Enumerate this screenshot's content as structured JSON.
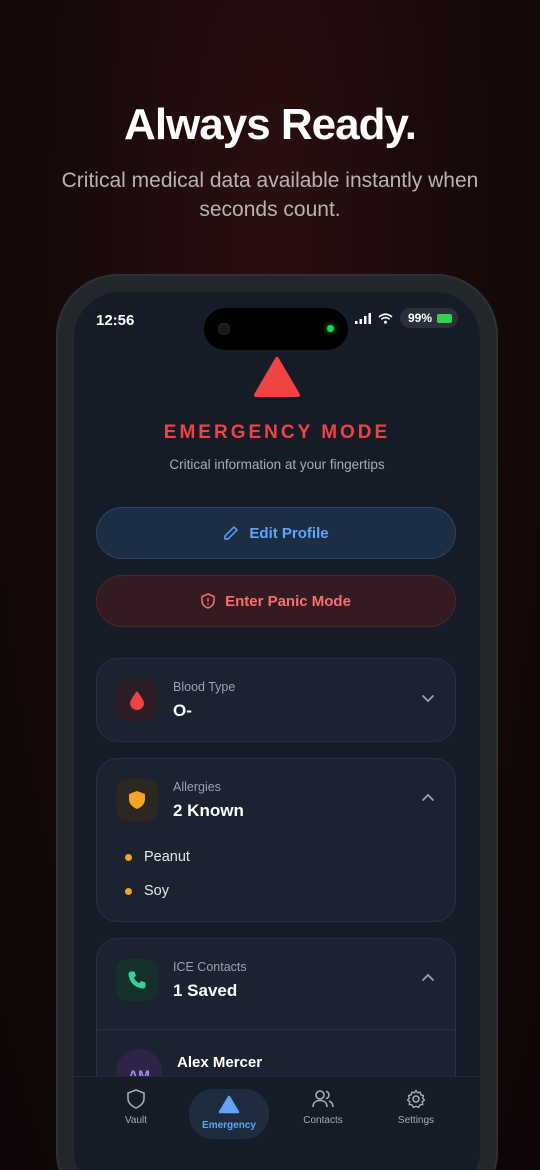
{
  "promo": {
    "headline": "Always Ready.",
    "subline": "Critical medical data available instantly when seconds count."
  },
  "status_bar": {
    "time": "12:56",
    "battery": "99%"
  },
  "header": {
    "title": "EMERGENCY MODE",
    "subtitle": "Critical information at your fingertips"
  },
  "actions": {
    "edit_label": "Edit Profile",
    "panic_label": "Enter Panic Mode"
  },
  "cards": {
    "blood": {
      "label": "Blood Type",
      "value": "O-"
    },
    "allergies": {
      "label": "Allergies",
      "value": "2 Known",
      "items": [
        "Peanut",
        "Soy"
      ]
    },
    "ice": {
      "label": "ICE Contacts",
      "value": "1 Saved",
      "contacts": [
        {
          "initials": "AM",
          "name": "Alex Mercer"
        }
      ]
    }
  },
  "tabs": [
    {
      "label": "Vault",
      "icon": "shield-icon"
    },
    {
      "label": "Emergency",
      "icon": "warning-icon",
      "active": true
    },
    {
      "label": "Contacts",
      "icon": "users-icon"
    },
    {
      "label": "Settings",
      "icon": "gear-icon"
    }
  ],
  "colors": {
    "accent_red": "#ef4444",
    "accent_blue": "#60a5fa",
    "allergy_amber": "#f5a524",
    "ice_green": "#34d399"
  }
}
